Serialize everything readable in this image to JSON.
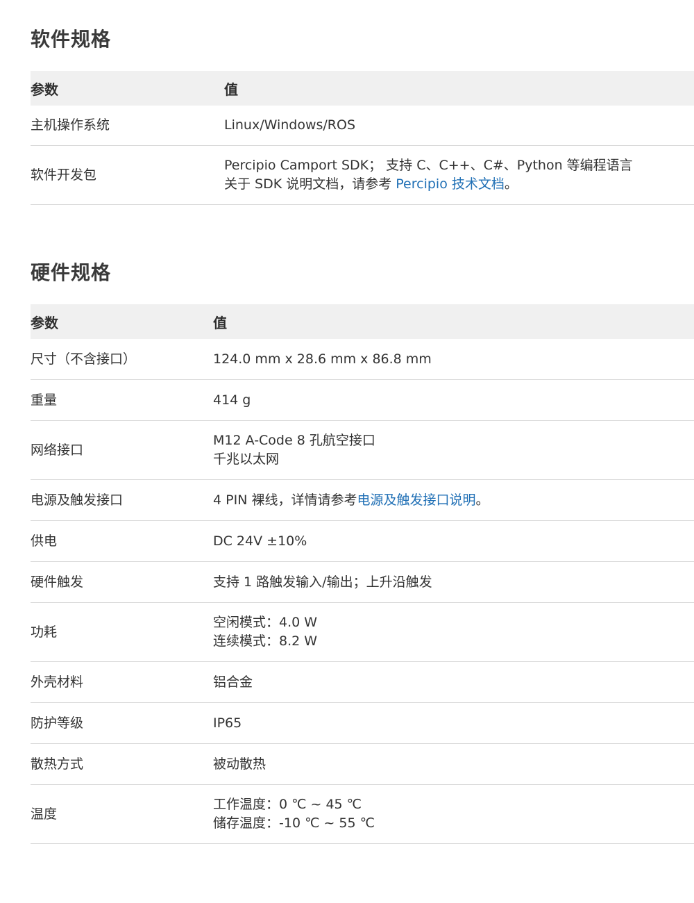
{
  "software": {
    "title": "软件规格",
    "header": {
      "param": "参数",
      "value": "值"
    },
    "rows": [
      {
        "param": "主机操作系统",
        "value_lines": [
          "Linux/Windows/ROS"
        ]
      },
      {
        "param": "软件开发包",
        "value_line1": "Percipio Camport SDK； 支持 C、C++、C#、Python 等编程语言",
        "value_line2_prefix": "关于 SDK 说明文档，请参考 ",
        "value_line2_link": "Percipio 技术文档",
        "value_line2_suffix": "。"
      }
    ]
  },
  "hardware": {
    "title": "硬件规格",
    "header": {
      "param": "参数",
      "value": "值"
    },
    "rows": [
      {
        "param": "尺寸（不含接口）",
        "value_lines": [
          "124.0 mm x 28.6 mm x 86.8 mm"
        ]
      },
      {
        "param": "重量",
        "value_lines": [
          "414 g"
        ]
      },
      {
        "param": "网络接口",
        "value_lines": [
          "M12 A-Code 8 孔航空接口",
          "千兆以太网"
        ]
      },
      {
        "param": "电源及触发接口",
        "value_prefix": "4 PIN 裸线，详情请参考",
        "value_link": "电源及触发接口说明",
        "value_suffix": "。"
      },
      {
        "param": "供电",
        "value_lines": [
          "DC 24V ±10%"
        ]
      },
      {
        "param": "硬件触发",
        "value_lines": [
          "支持 1 路触发输入/输出；上升沿触发"
        ]
      },
      {
        "param": "功耗",
        "value_lines": [
          "空闲模式：4.0 W",
          "连续模式：8.2 W"
        ]
      },
      {
        "param": "外壳材料",
        "value_lines": [
          "铝合金"
        ]
      },
      {
        "param": "防护等级",
        "value_lines": [
          "IP65"
        ]
      },
      {
        "param": "散热方式",
        "value_lines": [
          "被动散热"
        ]
      },
      {
        "param": "温度",
        "value_lines": [
          "工作温度：0 ℃ ~ 45 ℃",
          "储存温度：-10 ℃ ~ 55 ℃"
        ]
      }
    ]
  },
  "colors": {
    "link": "#1f6fb5",
    "header_bg": "#f0f0f0",
    "row_border": "#d9d9d9"
  }
}
